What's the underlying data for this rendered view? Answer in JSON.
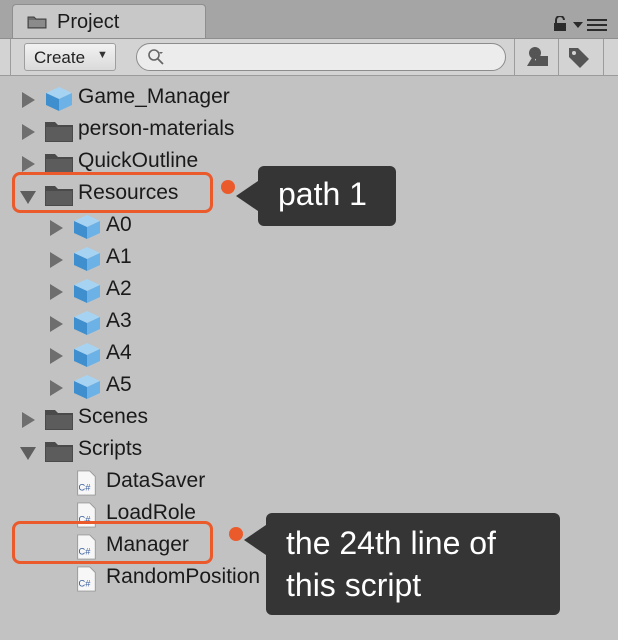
{
  "window": {
    "tab_title": "Project",
    "tab_icon": "folder-icon",
    "lock_icon": "lock-icon",
    "menu_icon": "panel-menu-icon"
  },
  "toolbar": {
    "create_label": "Create",
    "create_caret": "▼",
    "search_value": "",
    "filter_by_type_icon": "filter-by-type-icon",
    "filter_by_label_icon": "filter-by-label-icon"
  },
  "tree": {
    "items": [
      {
        "label": "Game_Manager",
        "icon": "prefab-cube-icon",
        "expanded": false
      },
      {
        "label": "person-materials",
        "icon": "folder-icon",
        "expanded": false
      },
      {
        "label": "QuickOutline",
        "icon": "folder-icon",
        "expanded": false
      },
      {
        "label": "Resources",
        "icon": "folder-icon",
        "expanded": true
      },
      {
        "label": "A0",
        "icon": "prefab-cube-icon",
        "expanded": false
      },
      {
        "label": "A1",
        "icon": "prefab-cube-icon",
        "expanded": false
      },
      {
        "label": "A2",
        "icon": "prefab-cube-icon",
        "expanded": false
      },
      {
        "label": "A3",
        "icon": "prefab-cube-icon",
        "expanded": false
      },
      {
        "label": "A4",
        "icon": "prefab-cube-icon",
        "expanded": false
      },
      {
        "label": "A5",
        "icon": "prefab-cube-icon",
        "expanded": false
      },
      {
        "label": "Scenes",
        "icon": "folder-icon",
        "expanded": false
      },
      {
        "label": "Scripts",
        "icon": "folder-icon",
        "expanded": true
      },
      {
        "label": "DataSaver",
        "icon": "csharp-script-icon"
      },
      {
        "label": "LoadRole",
        "icon": "csharp-script-icon"
      },
      {
        "label": "Manager",
        "icon": "csharp-script-icon"
      },
      {
        "label": "RandomPosition",
        "icon": "csharp-script-icon"
      }
    ],
    "script_icon_text": "C#"
  },
  "annotations": {
    "callout_1": "path 1",
    "callout_2": "the 24th line of this script",
    "accent_color": "#ea5a2b",
    "callout_bg": "#353535"
  }
}
